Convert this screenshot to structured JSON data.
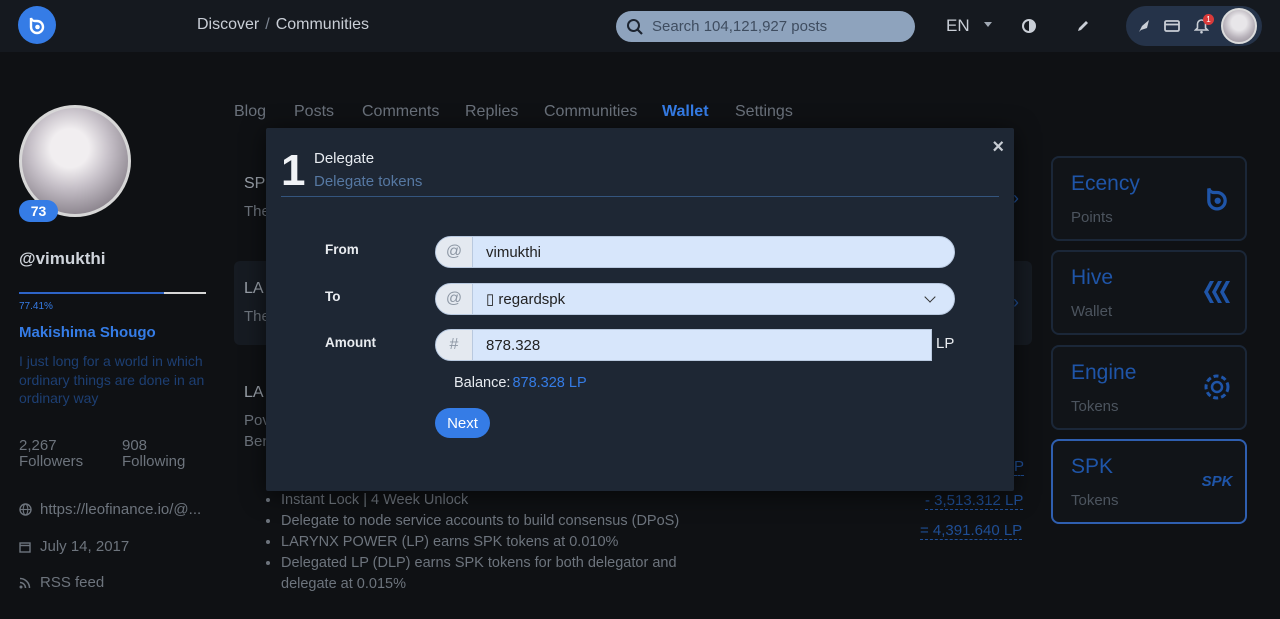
{
  "nav": {
    "breadcrumb": [
      "Discover",
      "Communities"
    ],
    "search_placeholder": "Search 104,121,927 posts",
    "language": "EN",
    "notification_count": "1"
  },
  "profile": {
    "reputation": "73",
    "username": "@vimukthi",
    "voting_power": "77.41%",
    "voting_power_fraction": 0.7741,
    "display_name": "Makishima Shougo",
    "about": "I just long for a world in which ordinary things are done in an ordinary way",
    "followers_count": "2,267",
    "followers_label": "Followers",
    "following_count": "908",
    "following_label": "Following",
    "website": "https://leofinance.io/@...",
    "joined": "July 14, 2017",
    "rss": "RSS feed"
  },
  "tabs": [
    "Blog",
    "Posts",
    "Comments",
    "Replies",
    "Communities",
    "Wallet",
    "Settings"
  ],
  "active_tab": "Wallet",
  "background": {
    "row1_title": "SP",
    "row1_desc": "The",
    "row2_title": "LA",
    "row2_desc": "The",
    "row3_title": "LA",
    "row3_desc1": "Pov",
    "row3_desc2": "Ben",
    "bullets": [
      "Instant Lock | 4 Week Unlock",
      "Delegate to node service accounts to build consensus (DPoS)",
      "LARYNX POWER (LP) earns SPK tokens at 0.010%",
      "Delegated LP (DLP) earns SPK tokens for both delegator and delegate at 0.015%"
    ],
    "values": [
      "P",
      "- 3,513.312 LP",
      "= 4,391.640 LP"
    ]
  },
  "right_cards": [
    {
      "title": "Ecency",
      "subtitle": "Points",
      "icon": "ecency-icon"
    },
    {
      "title": "Hive",
      "subtitle": "Wallet",
      "icon": "hive-icon"
    },
    {
      "title": "Engine",
      "subtitle": "Tokens",
      "icon": "engine-icon"
    },
    {
      "title": "SPK",
      "subtitle": "Tokens",
      "icon": "spk-icon"
    }
  ],
  "modal": {
    "step": "1",
    "title": "Delegate",
    "subtitle": "Delegate tokens",
    "close": "×",
    "from_label": "From",
    "from_prefix": "@",
    "from_value": "vimukthi",
    "to_label": "To",
    "to_prefix": "@",
    "to_value": "▯ regardspk",
    "amount_label": "Amount",
    "amount_prefix": "#",
    "amount_value": "878.328",
    "amount_unit": "LP",
    "balance_label": "Balance:",
    "balance_value": "878.328 LP",
    "next_label": "Next"
  },
  "colors": {
    "accent": "#357ce6",
    "background": "#0f1114",
    "modal": "#1e2734",
    "input": "#d7e6fb"
  }
}
